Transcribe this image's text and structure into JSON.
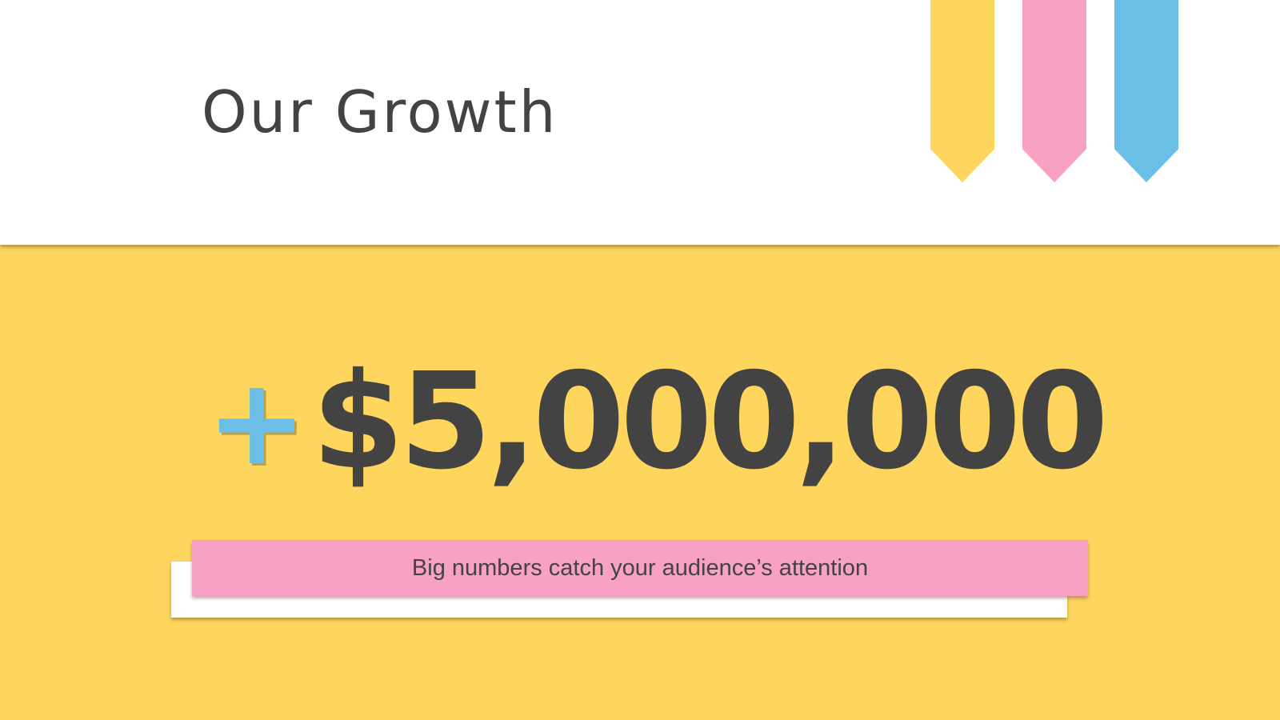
{
  "header": {
    "title": "Our Growth"
  },
  "ribbons": [
    {
      "color": "#fed65d"
    },
    {
      "color": "#f8a1c5"
    },
    {
      "color": "#6bbfe6"
    }
  ],
  "main": {
    "plus_sign": "+",
    "amount": "$5,000,000",
    "caption": "Big numbers catch your audience’s attention"
  },
  "colors": {
    "background": "#fed65d",
    "header_bg": "#ffffff",
    "text": "#434343",
    "accent_blue": "#6bbfe6",
    "accent_pink": "#f8a1c5"
  }
}
